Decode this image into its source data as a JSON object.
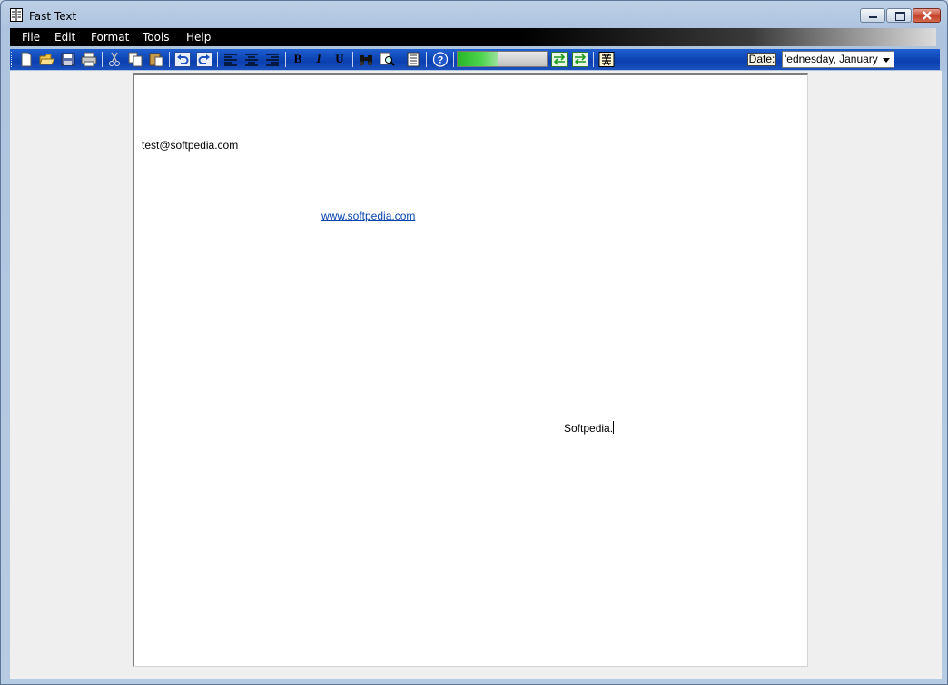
{
  "window": {
    "title": "Fast Text"
  },
  "menu": [
    "File",
    "Edit",
    "Format",
    "Tools",
    "Help"
  ],
  "toolbar": {
    "buttons": [
      "new-file",
      "open-file",
      "save-file",
      "print",
      "cut",
      "copy",
      "paste",
      "undo",
      "redo",
      "align-left",
      "align-center",
      "align-right",
      "bold",
      "italic",
      "underline",
      "find",
      "replace",
      "notes",
      "help",
      "convert-1",
      "convert-2",
      "tool-extra"
    ],
    "bold_label": "B",
    "italic_label": "I",
    "underline_label": "U",
    "progress": 0.45,
    "date_label": "Date:",
    "date_value": "'ednesday,   January"
  },
  "document": {
    "email": "test@softpedia.com",
    "link": "www.softpedia.com",
    "text": "Softpedia."
  },
  "colors": {
    "menubar": "#000000",
    "toolbar": "#0b3fae",
    "link": "#0645ad"
  }
}
